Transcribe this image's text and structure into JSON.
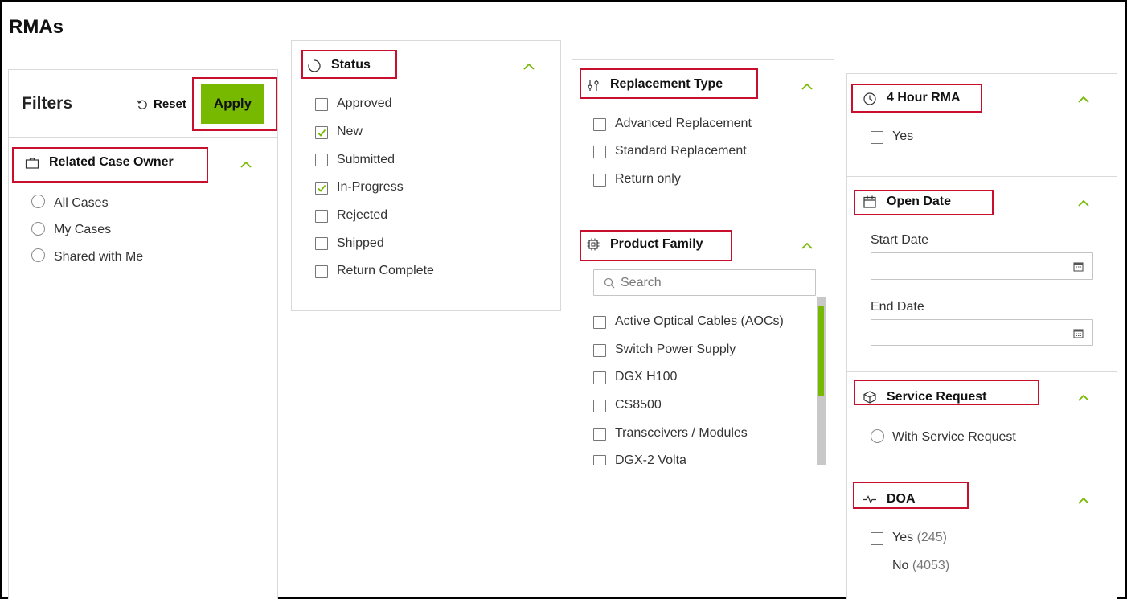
{
  "page": {
    "title": "RMAs"
  },
  "filters": {
    "title": "Filters",
    "reset_label": "Reset",
    "apply_label": "Apply"
  },
  "related_case_owner": {
    "title": "Related Case Owner",
    "options": [
      "All Cases",
      "My Cases",
      "Shared with Me"
    ]
  },
  "status": {
    "title": "Status",
    "options": [
      {
        "label": "Approved",
        "checked": false
      },
      {
        "label": "New",
        "checked": true
      },
      {
        "label": "Submitted",
        "checked": false
      },
      {
        "label": "In-Progress",
        "checked": true
      },
      {
        "label": "Rejected",
        "checked": false
      },
      {
        "label": "Shipped",
        "checked": false
      },
      {
        "label": "Return Complete",
        "checked": false
      }
    ]
  },
  "replacement_type": {
    "title": "Replacement Type",
    "options": [
      "Advanced Replacement",
      "Standard Replacement",
      "Return only"
    ]
  },
  "product_family": {
    "title": "Product Family",
    "search_placeholder": "Search",
    "options": [
      "Active Optical Cables (AOCs)",
      "Switch Power Supply",
      "DGX H100",
      "CS8500",
      "Transceivers / Modules",
      "DGX-2 Volta"
    ]
  },
  "four_hour_rma": {
    "title": "4 Hour RMA",
    "options": [
      "Yes"
    ]
  },
  "open_date": {
    "title": "Open Date",
    "start_label": "Start Date",
    "end_label": "End Date"
  },
  "service_request": {
    "title": "Service Request",
    "options": [
      "With Service Request"
    ]
  },
  "doa": {
    "title": "DOA",
    "options": [
      {
        "label": "Yes",
        "count": "(245)"
      },
      {
        "label": "No",
        "count": "(4053)"
      }
    ]
  },
  "colors": {
    "accent": "#76b900",
    "highlight": "#c8102e",
    "border": "#d9d9d9"
  },
  "icons": [
    "reset-icon",
    "briefcase-icon",
    "spinner-icon",
    "sliders-icon",
    "chip-icon",
    "search-icon",
    "clock-icon",
    "calendar-icon",
    "box-icon",
    "pulse-icon",
    "chevron-up-icon",
    "checkmark-icon"
  ]
}
